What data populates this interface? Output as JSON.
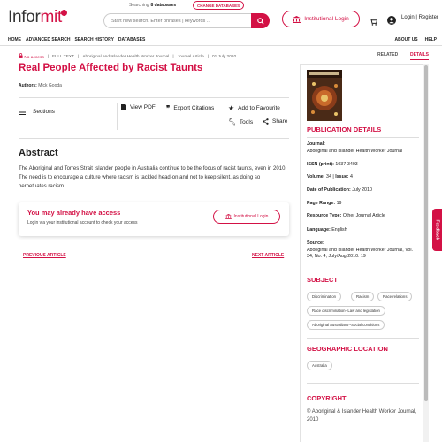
{
  "header": {
    "logo_part1": "Infor",
    "logo_part2": "mit",
    "searching_label": "Searching",
    "databases_count": "8 databases",
    "change_databases": "CHANGE DATABASES",
    "search_placeholder": "Start new search. Enter phrases | keywords ...",
    "institutional_login": "Institutional Login",
    "login_register": "Login | Register"
  },
  "nav": {
    "items": [
      "HOME",
      "ADVANCED SEARCH",
      "SEARCH HISTORY",
      "DATABASES"
    ],
    "right": [
      "ABOUT US",
      "HELP"
    ]
  },
  "article": {
    "access": "No access",
    "full_text": "FULL TEXT",
    "journal": "Aboriginal and Islander Health Worker Journal",
    "type": "Journal Article",
    "date": "01 July 2010",
    "title": "Real People Affected by Racist Taunts",
    "authors_label": "Authors:",
    "authors": "Mick Gooda",
    "sections_label": "Sections",
    "actions": {
      "view_pdf": "View PDF",
      "export": "Export Citations",
      "favourite": "Add to Favourite",
      "tools": "Tools",
      "share": "Share"
    },
    "abstract_heading": "Abstract",
    "abstract_text": "The Aboriginal and Torres Strait Islander people in Australia continue to be the focus of racist taunts, even in 2010. The need is to encourage a culture where racism is tackled head-on and not to keep silent, as doing so perpetuates racism.",
    "access_card": {
      "heading": "You may already have access",
      "text": "Login via your institutional account to check your access",
      "button": "Institutional Login"
    },
    "prev": "PREVIOUS ARTICLE",
    "next": "NEXT ARTICLE"
  },
  "panel": {
    "tab_related": "RELATED",
    "tab_details": "DETAILS",
    "pub_heading": "PUBLICATION DETAILS",
    "journal_label": "Journal:",
    "journal_value": "Aboriginal and Islander Health Worker Journal",
    "issn_label": "ISSN (print):",
    "issn_value": "1037-3403",
    "volume_label": "Volume:",
    "volume_value": "34",
    "issue_label": "Issue:",
    "issue_value": "4",
    "date_label": "Date of Publication:",
    "date_value": "July 2010",
    "page_label": "Page Range:",
    "page_value": "19",
    "resource_label": "Resource Type:",
    "resource_value": "Other Journal Article",
    "language_label": "Language:",
    "language_value": "English",
    "source_label": "Source:",
    "source_value": "Aboriginal and Islander Health Worker Journal, Vol. 34, No. 4, July/Aug 2010: 19",
    "subject_heading": "SUBJECT",
    "subjects": [
      "Discrimination",
      "Racism",
      "Race relations",
      "Race discrimination--Law and legislation",
      "Aboriginal Australians--Social conditions"
    ],
    "geo_heading": "GEOGRAPHIC LOCATION",
    "geo": [
      "Australia"
    ],
    "copyright_heading": "COPYRIGHT",
    "copyright_text": "© Aboriginal & Islander Health Worker Journal, 2010"
  },
  "feedback": "Feedback",
  "colors": {
    "accent": "#d31145"
  }
}
